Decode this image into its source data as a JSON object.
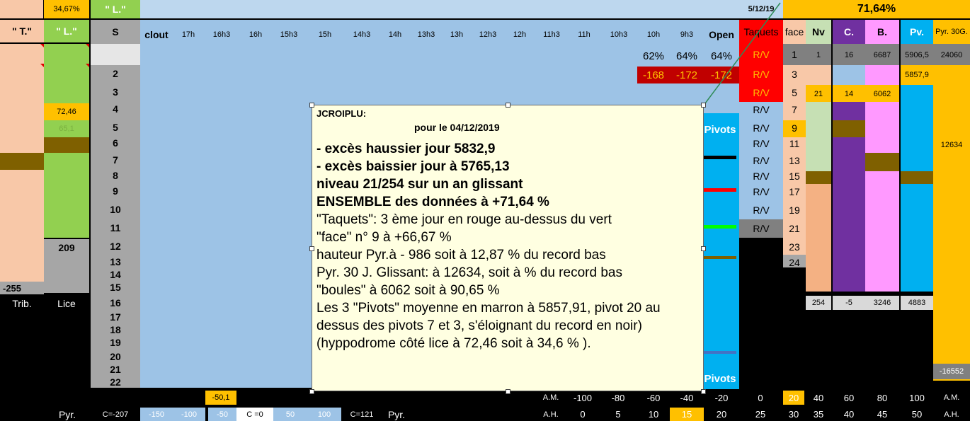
{
  "top_row": {
    "pct_l": "34,67%",
    "l_label": "\" L.\"",
    "date": "5/12/19",
    "pct_big": "71,64%"
  },
  "header": {
    "t": "\" T.\"",
    "l": "\" L.\"",
    "s": "S",
    "clout": "clout",
    "hours": [
      "17h",
      "16h3",
      "16h",
      "15h3",
      "15h",
      "14h3",
      "14h",
      "13h3",
      "13h",
      "12h3",
      "12h",
      "11h3",
      "11h",
      "10h3",
      "10h",
      "9h3"
    ],
    "open": "Open",
    "taquets": "Taquets",
    "face": "face",
    "nv": "Nv",
    "c": "C.",
    "b": "B.",
    "pv": "Pv.",
    "pyr30": "Pyr. 30G."
  },
  "s_numbers": [
    "2",
    "3",
    "4",
    "5",
    "6",
    "7",
    "8",
    "9",
    "10",
    "11",
    "12",
    "13",
    "14",
    "15",
    "16",
    "17",
    "18",
    "19",
    "20",
    "21",
    "22"
  ],
  "l_col": {
    "v1": "72,46",
    "v2": "65,1",
    "v3": "209"
  },
  "t_col": {
    "v1": "-255"
  },
  "labels": {
    "trib": "Trib.",
    "lice": "Lice"
  },
  "pct_row": [
    "62%",
    "64%",
    "64%"
  ],
  "neg_row": [
    "-168",
    "-172",
    "-172"
  ],
  "taquets": [
    "R/V",
    "R/V",
    "R/V",
    "R/V",
    "R/V",
    "R/V",
    "R/V",
    "R/V",
    "R/V",
    "R/V",
    "R/V"
  ],
  "face": [
    "1",
    "3",
    "5",
    "7",
    "9",
    "11",
    "13",
    "15",
    "17",
    "19",
    "21",
    "23",
    "24"
  ],
  "row1": {
    "nv": "1",
    "c": "16",
    "b": "6687",
    "pv": "5906,5",
    "pyr": "24060"
  },
  "row2": {
    "pv": "5857,9"
  },
  "row3": {
    "nv": "21",
    "c": "14",
    "b": "6062"
  },
  "pyr_mid": "12634",
  "bottom_totals": {
    "nv": "254",
    "c": "-5",
    "b": "3246",
    "pv": "4883",
    "pyr": "-16552"
  },
  "pivots": {
    "label": "Pivots"
  },
  "note": {
    "author": "JCROIPLU:",
    "for_date": "pour le 04/12/2019",
    "lines_bold": [
      "- excès haussier jour 5832,9",
      "- excès baissier jour à 5765,13",
      "niveau  21/254 sur un an glissant",
      "ENSEMBLE des données à +71,64 %"
    ],
    "lines": [
      "\"Taquets\": 3 ème jour en rouge au-dessus du vert",
      "\"face\" n° 9  à +66,67 %",
      " hauteur Pyr.à - 986 soit à 12,87 % du record bas",
      "Pyr. 30 J. Glissant: à 12634, soit  à  % du record bas",
      "\"boules\" à 6062  soit à 90,65 %",
      "Les 3 \"Pivots\" moyenne en marron à 5857,91, pivot 20 au",
      "dessus des pivots 7 et 3, s'éloignant du record en noir)",
      "(hyppodrome côté lice  à 72,46 soit à 34,6 % )."
    ],
    "lead_dash": "-"
  },
  "am_row": {
    "val1": "-50,1",
    "am": "A.M.",
    "vals": [
      "-100",
      "-80",
      "-60",
      "-40",
      "-20",
      "0",
      "20",
      "40",
      "60",
      "80",
      "100"
    ],
    "am2": "A.M."
  },
  "ah_row": {
    "pyr": "Pyr.",
    "c207": "C=-207",
    "vals1": [
      "-150",
      "-100",
      "-50"
    ],
    "c0": "C =0",
    "vals2": [
      "50",
      "100"
    ],
    "c121": "C=121",
    "pyr2": "Pyr.",
    "ah": "A.H.",
    "vals3": [
      "0",
      "5",
      "10",
      "15",
      "20",
      "25",
      "30",
      "35",
      "40",
      "45",
      "50"
    ],
    "ah2": "A.H."
  },
  "colors": {
    "salmon": "#f8c8a8",
    "green": "#92d050",
    "gray": "#a6a6a6",
    "blue": "#9dc3e6",
    "yellow": "#ffc000",
    "red": "#ff0000",
    "purple": "#7030a0",
    "pink": "#ff99ff",
    "cyan": "#00b0f0",
    "brown": "#7f6000"
  }
}
